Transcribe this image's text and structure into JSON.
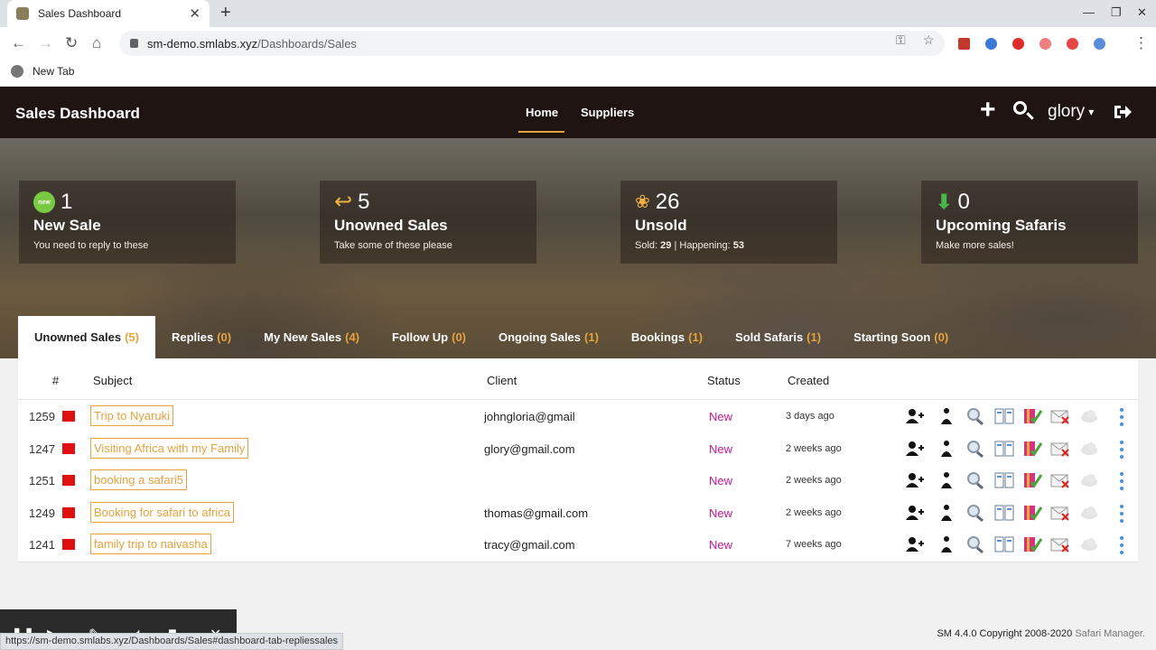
{
  "browser": {
    "tab_title": "Sales Dashboard",
    "url_host": "sm-demo.smlabs.xyz",
    "url_path": "/Dashboards/Sales",
    "bookmark": "New Tab",
    "status_url": "https://sm-demo.smlabs.xyz/Dashboards/Sales#dashboard-tab-repliessales"
  },
  "nav": {
    "brand": "Sales Dashboard",
    "links": [
      "Home",
      "Suppliers"
    ],
    "user": "glory"
  },
  "cards": [
    {
      "icon": "new-badge-icon",
      "icon_text": "new",
      "count": "1",
      "title": "New Sale",
      "sub": "You need to reply to these"
    },
    {
      "icon": "reply-arrow-icon",
      "count": "5",
      "title": "Unowned Sales",
      "sub": "Take some of these please"
    },
    {
      "icon": "paw-icon",
      "count": "26",
      "title": "Unsold",
      "sub_parts": {
        "sold_label": "Sold:",
        "sold": "29",
        "sep": "|",
        "happening_label": "Happening:",
        "happening": "53"
      }
    },
    {
      "icon": "down-arrow-icon",
      "count": "0",
      "title": "Upcoming Safaris",
      "sub": "Make more sales!"
    }
  ],
  "tabs": [
    {
      "label": "Unowned Sales",
      "count": "(5)"
    },
    {
      "label": "Replies",
      "count": "(0)"
    },
    {
      "label": "My New Sales",
      "count": "(4)"
    },
    {
      "label": "Follow Up",
      "count": "(0)"
    },
    {
      "label": "Ongoing Sales",
      "count": "(1)"
    },
    {
      "label": "Bookings",
      "count": "(1)"
    },
    {
      "label": "Sold Safaris",
      "count": "(1)"
    },
    {
      "label": "Starting Soon",
      "count": "(0)"
    }
  ],
  "table": {
    "headers": [
      "#",
      "Subject",
      "Client",
      "Status",
      "Created"
    ],
    "rows": [
      {
        "id": "1259",
        "subject": "Trip to Nyaruki",
        "client": "johngloria@gmail",
        "status": "New",
        "created": "3 days ago"
      },
      {
        "id": "1247",
        "subject": "Visiting Africa with my Family",
        "client": "glory@gmail.com",
        "status": "New",
        "created": "2 weeks ago"
      },
      {
        "id": "1251",
        "subject": "booking a safari5",
        "client": "",
        "status": "New",
        "created": "2 weeks ago"
      },
      {
        "id": "1249",
        "subject": "Booking for safari to africa",
        "client": "thomas@gmail.com",
        "status": "New",
        "created": "2 weeks ago"
      },
      {
        "id": "1241",
        "subject": "family trip to naivasha",
        "client": "tracy@gmail.com",
        "status": "New",
        "created": "7 weeks ago"
      }
    ],
    "row_actions": [
      "add-user-icon",
      "assign-person-icon",
      "search-icon",
      "compare-icon",
      "book-icon",
      "email-delete-icon",
      "cloud-icon",
      "more-icon"
    ]
  },
  "footer": {
    "version": "SM 4.4.0 Copyright 2008-2020",
    "brand": "Safari Manager."
  }
}
